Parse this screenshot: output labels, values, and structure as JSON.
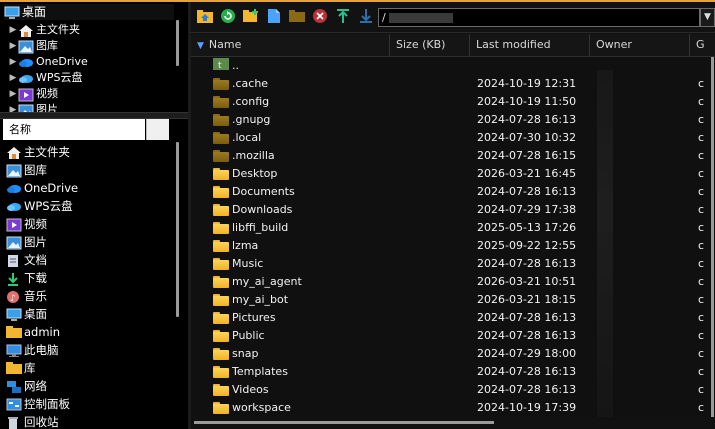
{
  "tree": {
    "root_label": "桌面",
    "items": [
      {
        "label": "主文件夹",
        "icon": "home-icon"
      },
      {
        "label": "图库",
        "icon": "gallery-icon"
      },
      {
        "label": "OneDrive",
        "icon": "cloud-icon"
      },
      {
        "label": "WPS云盘",
        "icon": "wps-cloud-icon"
      },
      {
        "label": "视频",
        "icon": "video-icon"
      },
      {
        "label": "图片",
        "icon": "pictures-icon"
      }
    ]
  },
  "places": {
    "header": "名称",
    "items": [
      {
        "label": "主文件夹",
        "icon": "home-icon"
      },
      {
        "label": "图库",
        "icon": "gallery-icon"
      },
      {
        "label": "OneDrive",
        "icon": "cloud-icon"
      },
      {
        "label": "WPS云盘",
        "icon": "wps-cloud-icon"
      },
      {
        "label": "视频",
        "icon": "video-icon"
      },
      {
        "label": "图片",
        "icon": "pictures-icon"
      },
      {
        "label": "文档",
        "icon": "documents-icon"
      },
      {
        "label": "下载",
        "icon": "download-icon"
      },
      {
        "label": "音乐",
        "icon": "music-icon"
      },
      {
        "label": "桌面",
        "icon": "desktop-icon"
      },
      {
        "label": "admin",
        "icon": "user-folder-icon"
      },
      {
        "label": "此电脑",
        "icon": "computer-icon"
      },
      {
        "label": "库",
        "icon": "library-icon"
      },
      {
        "label": "网络",
        "icon": "network-icon"
      },
      {
        "label": "控制面板",
        "icon": "control-panel-icon"
      },
      {
        "label": "回收站",
        "icon": "trash-icon"
      }
    ]
  },
  "toolbar": {
    "buttons": [
      "up-folder-icon",
      "refresh-icon",
      "new-folder-icon",
      "new-file-icon",
      "folder-icon",
      "delete-icon",
      "upload-icon",
      "download-icon"
    ]
  },
  "path": {
    "value": "/"
  },
  "columns": {
    "name": "Name",
    "size": "Size (KB)",
    "modified": "Last modified",
    "owner": "Owner",
    "group": "G"
  },
  "files": [
    {
      "name": "..",
      "modified": "",
      "group": "",
      "icon": "parent-dir-icon"
    },
    {
      "name": ".cache",
      "modified": "2024-10-19 12:31",
      "group": "c",
      "icon": "hidden-folder-icon"
    },
    {
      "name": ".config",
      "modified": "2024-10-19 11:50",
      "group": "c",
      "icon": "hidden-folder-icon"
    },
    {
      "name": ".gnupg",
      "modified": "2024-07-28 16:13",
      "group": "c",
      "icon": "hidden-folder-icon"
    },
    {
      "name": ".local",
      "modified": "2024-07-30 10:32",
      "group": "c",
      "icon": "hidden-folder-icon"
    },
    {
      "name": ".mozilla",
      "modified": "2024-07-28 16:15",
      "group": "c",
      "icon": "hidden-folder-icon"
    },
    {
      "name": "Desktop",
      "modified": "2026-03-21 16:45",
      "group": "c",
      "icon": "folder-icon"
    },
    {
      "name": "Documents",
      "modified": "2024-07-28 16:13",
      "group": "c",
      "icon": "folder-icon"
    },
    {
      "name": "Downloads",
      "modified": "2024-07-29 17:38",
      "group": "c",
      "icon": "folder-icon"
    },
    {
      "name": "libffi_build",
      "modified": "2025-05-13 17:26",
      "group": "c",
      "icon": "folder-icon"
    },
    {
      "name": "lzma",
      "modified": "2025-09-22 12:55",
      "group": "c",
      "icon": "folder-icon"
    },
    {
      "name": "Music",
      "modified": "2024-07-28 16:13",
      "group": "c",
      "icon": "folder-icon"
    },
    {
      "name": "my_ai_agent",
      "modified": "2026-03-21 10:51",
      "group": "c",
      "icon": "folder-icon"
    },
    {
      "name": "my_ai_bot",
      "modified": "2026-03-21 18:15",
      "group": "c",
      "icon": "folder-icon"
    },
    {
      "name": "Pictures",
      "modified": "2024-07-28 16:13",
      "group": "c",
      "icon": "folder-icon"
    },
    {
      "name": "Public",
      "modified": "2024-07-28 16:13",
      "group": "c",
      "icon": "folder-icon"
    },
    {
      "name": "snap",
      "modified": "2024-07-29 18:00",
      "group": "c",
      "icon": "folder-icon"
    },
    {
      "name": "Templates",
      "modified": "2024-07-28 16:13",
      "group": "c",
      "icon": "folder-icon"
    },
    {
      "name": "Videos",
      "modified": "2024-07-28 16:13",
      "group": "c",
      "icon": "folder-icon"
    },
    {
      "name": "workspace",
      "modified": "2024-10-19 17:39",
      "group": "c",
      "icon": "folder-icon"
    }
  ],
  "colors": {
    "accent": "#e8a23a",
    "folder": "#f2b630",
    "hidden_folder": "#8a6a16",
    "sort": "#5aa0ff"
  }
}
